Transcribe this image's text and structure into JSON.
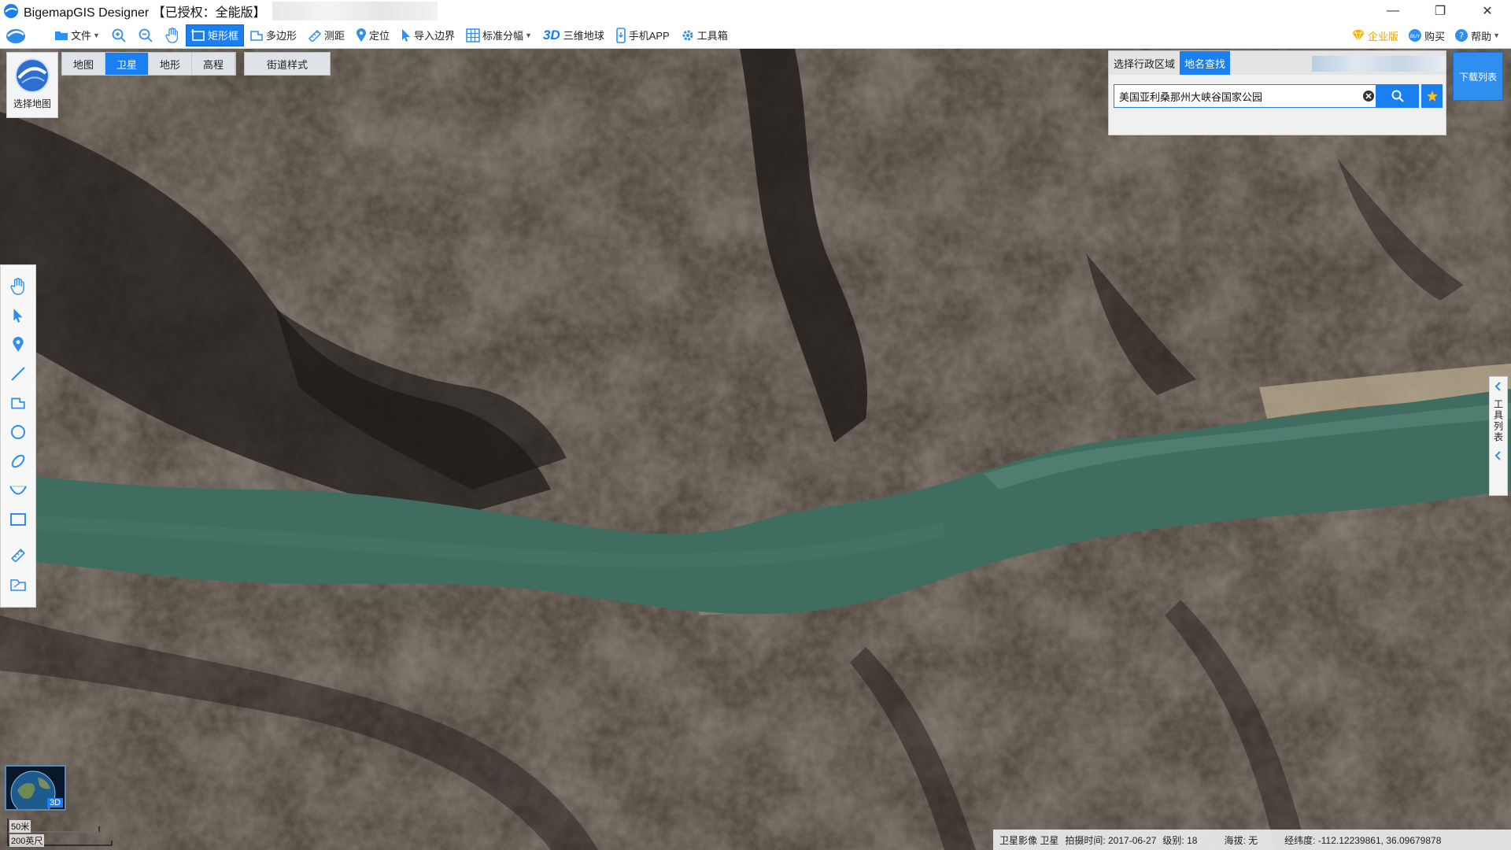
{
  "window": {
    "title": "BigemapGIS Designer 【已授权：全能版】",
    "minimize": "—",
    "maximize": "❐",
    "close": "✕"
  },
  "toolbar": {
    "file": "文件",
    "rect_select": "矩形框",
    "polygon": "多边形",
    "measure": "测距",
    "locate": "定位",
    "import_boundary": "导入边界",
    "standard_sheet": "标准分幅",
    "threeD_label": "3D",
    "globe_3d": "三维地球",
    "mobile_app": "手机APP",
    "toolbox": "工具箱",
    "enterprise": "企业版",
    "buy": "购买",
    "help": "帮助"
  },
  "maptypes": {
    "items": [
      "地图",
      "卫星",
      "地形",
      "高程"
    ],
    "active_index": 1,
    "street_style": "街道样式"
  },
  "selectmap": {
    "label": "选择地图"
  },
  "search": {
    "tab_region": "选择行政区域",
    "tab_place": "地名查找",
    "query": "美国亚利桑那州大峡谷国家公园"
  },
  "download_list": "下载列表",
  "right_tools": {
    "label": "工具列表"
  },
  "globe3d_tag": "3D",
  "scale": {
    "metric": "50米",
    "imperial": "200英尺"
  },
  "status": {
    "imagery": "卫星影像 卫星",
    "capture_date": "拍摄时间: 2017-06-27",
    "level": "级别:  18",
    "elevation": "海拔: 无",
    "coords": "经纬度:   -112.12239861, 36.09679878"
  },
  "colors": {
    "accent": "#1a7ff0",
    "river": "#3f6f60",
    "rock": "#544b43"
  }
}
